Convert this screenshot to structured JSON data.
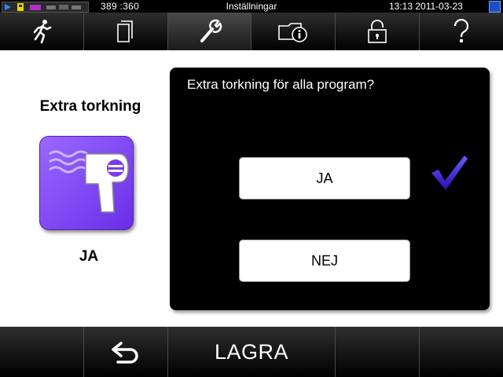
{
  "status": {
    "coords": "389 :360",
    "title": "Inställningar",
    "datetime": "13:13   2011-03-23"
  },
  "nav": {
    "items": [
      {
        "icon": "running-person-icon"
      },
      {
        "icon": "documents-icon"
      },
      {
        "icon": "wrench-icon",
        "active": true
      },
      {
        "icon": "folder-info-icon"
      },
      {
        "icon": "padlock-icon"
      },
      {
        "icon": "help-icon"
      }
    ]
  },
  "feature": {
    "title": "Extra torkning",
    "icon": "hair-dryer-icon",
    "value": "JA"
  },
  "dialog": {
    "question": "Extra torkning för alla program?",
    "yes_label": "JA",
    "no_label": "NEJ",
    "selected": "JA"
  },
  "bottom": {
    "back_icon": "back-arrow-icon",
    "save_label": "LAGRA"
  },
  "colors": {
    "accent_purple": "#7a3cf0",
    "check_blue": "#3a1fd0"
  }
}
